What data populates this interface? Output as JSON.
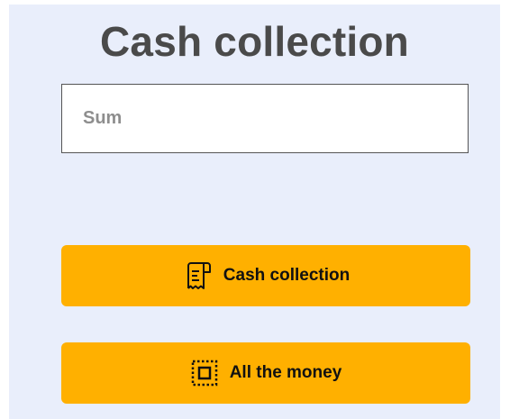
{
  "title": "Cash collection",
  "sum_input": {
    "placeholder": "Sum",
    "value": ""
  },
  "buttons": {
    "cash_collection": {
      "label": "Cash collection",
      "icon": "receipt-icon"
    },
    "all_money": {
      "label": "All the money",
      "icon": "select-all-icon"
    }
  },
  "colors": {
    "background": "#e9eefb",
    "button": "#ffb000",
    "title": "#4a4a4a"
  }
}
